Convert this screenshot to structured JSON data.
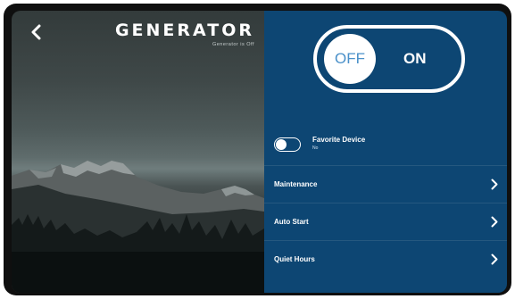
{
  "header": {
    "title": "GENERATOR",
    "subtitle": "Generator is Off"
  },
  "icons": {
    "back": "chevron-left-icon",
    "menu_arrow": "chevron-right-icon"
  },
  "power_switch": {
    "off_label": "OFF",
    "on_label": "ON",
    "state": "off"
  },
  "favorite": {
    "label": "Favorite Device",
    "status": "No",
    "enabled": false
  },
  "menu": {
    "items": [
      {
        "label": "Maintenance"
      },
      {
        "label": "Auto Start"
      },
      {
        "label": "Quiet Hours"
      }
    ]
  },
  "colors": {
    "panel_blue": "#0d4673",
    "knob_text_blue": "#4a90c9",
    "divider": "#25587f",
    "white": "#ffffff"
  }
}
